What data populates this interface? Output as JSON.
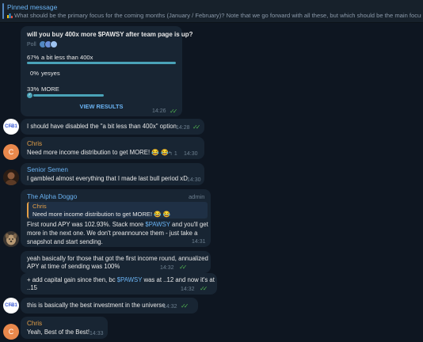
{
  "pinned": {
    "title": "Pinned message",
    "text": "What should be the primary focus for the coming months (January / February)? Note that we go forward with all these, but which should be the main focus?"
  },
  "poll": {
    "question": "will you buy 400x more $PAWSY after team page is up?",
    "label": "Poll",
    "options": [
      {
        "percent": "67%",
        "label": "a bit less than 400x",
        "fraction": 0.67
      },
      {
        "percent": "0%",
        "label": "yesyes",
        "fraction": 0
      },
      {
        "percent": "33%",
        "label": "MORE",
        "fraction": 0.33
      }
    ],
    "view_results": "VIEW RESULTS",
    "time": "14:26"
  },
  "messages": {
    "m1": {
      "avatar": "CF̶B1",
      "text": "I should have disabled the \"a bit less than 400x\" option",
      "time": "14:28"
    },
    "m2": {
      "avatar": "C",
      "name": "Chris",
      "name_color": "#e39f47",
      "text": "Need more income distribution to get MORE! 😂 😂",
      "replies": "1",
      "time": "14:30"
    },
    "m3": {
      "name": "Senior Semen",
      "name_color": "#6ab3f3",
      "text": "I gambled almost everything that I made last bull period xD",
      "time": "14:30"
    },
    "m4": {
      "name": "The Alpha Doggo",
      "name_color": "#6ab3f3",
      "badge": "admin",
      "quote_name": "Chris",
      "quote_text": "Need more income distribution to get MORE! 😂 😂",
      "line1_a": "First round APY was 102.93%. Stack more ",
      "line1_link": "$PAWSY",
      "line1_b": " and you'll get",
      "line2": "more in the next one. We don't preannounce them - just take a",
      "line3": "snapshot and start sending.",
      "time": "14:31"
    },
    "m5": {
      "line1": "yeah basically for those that got the first income round, annualized",
      "line2": "APY at time of sending was 100%",
      "time": "14:32"
    },
    "m6": {
      "line1_a": "+ add capital gain since then, bc ",
      "line1_link": "$PAWSY",
      "line1_b": " was at ..12 and now it's at",
      "line2": "..15",
      "time": "14:32"
    },
    "m7": {
      "avatar": "CF̶B1",
      "text": "this is basically the best investment in the universe",
      "time": "14:32"
    },
    "m8": {
      "avatar": "C",
      "name": "Chris",
      "name_color": "#e39f47",
      "text": "Yeah, Best of the Best!",
      "time": "14:33"
    }
  },
  "colors": {
    "background": "#0e1621",
    "bubble": "#182533",
    "accent": "#6ab3f3",
    "read_ticks": "#4fae4e",
    "poll_bar": "#4aa3b8"
  }
}
